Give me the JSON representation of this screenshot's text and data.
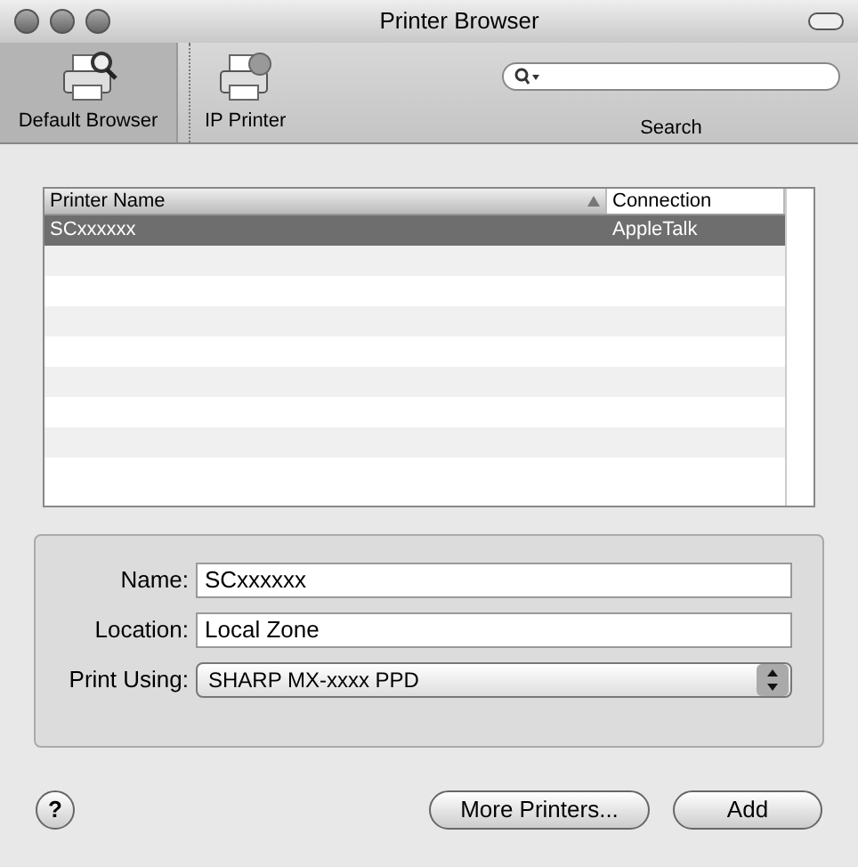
{
  "window": {
    "title": "Printer Browser"
  },
  "toolbar": [
    {
      "label": "Default Browser",
      "kind": "default",
      "selected": true
    },
    {
      "label": "IP Printer",
      "kind": "ip",
      "selected": false
    }
  ],
  "search": {
    "label": "Search"
  },
  "table": {
    "columns": [
      {
        "label": "Printer Name",
        "sorted": true
      },
      {
        "label": "Connection",
        "sorted": false
      }
    ],
    "rows": [
      {
        "cells": [
          "SCxxxxxx",
          "AppleTalk"
        ],
        "selected": true
      }
    ]
  },
  "form": {
    "fields": [
      {
        "label": "Name:",
        "value": "SCxxxxxx",
        "kind": "text"
      },
      {
        "label": "Location:",
        "value": "Local Zone",
        "kind": "text"
      },
      {
        "label": "Print Using:",
        "value": "SHARP MX-xxxx PPD",
        "kind": "popup"
      }
    ]
  },
  "help": "?",
  "buttons": [
    "More Printers...",
    "Add"
  ]
}
